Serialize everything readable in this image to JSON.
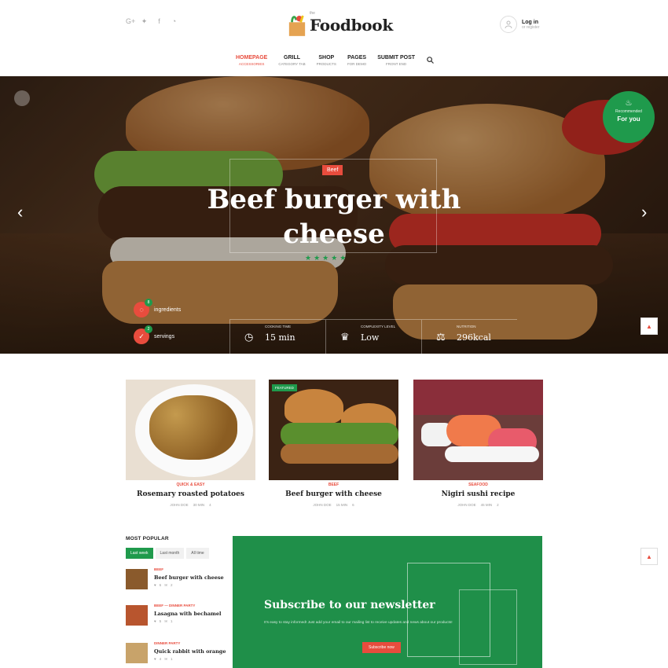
{
  "header": {
    "social_icons": [
      "google-plus-icon",
      "twitter-icon",
      "facebook-icon",
      "rss-icon"
    ],
    "social_glyphs": [
      "G+",
      "✦",
      "f",
      "◔"
    ],
    "logo_small": "the",
    "logo_text": "Foodbook",
    "login_label": "Log in",
    "login_sub": "or register"
  },
  "nav": {
    "items": [
      {
        "label": "HOMEPAGE",
        "sub": "ACCESSORIES",
        "active": true
      },
      {
        "label": "GRILL",
        "sub": "CATEGORY TAB"
      },
      {
        "label": "SHOP",
        "sub": "PRODUCTS"
      },
      {
        "label": "PAGES",
        "sub": "FOR DEMO"
      },
      {
        "label": "SUBMIT POST",
        "sub": "FRONT END"
      }
    ]
  },
  "hero": {
    "category": "Beef",
    "title_line1": "Beef burger with",
    "title_line2": "cheese",
    "rating_stars": "★★★★★",
    "badge_sub": "Recommended",
    "badge_label": "For you",
    "ingredients_label": "ingredients",
    "ingredients_count": "8",
    "servings_label": "servings",
    "servings_count": "2",
    "stats": [
      {
        "label": "COOKING TIME",
        "value": "15 min",
        "icon": "clock-icon"
      },
      {
        "label": "COMPLEXITY LEVEL",
        "value": "Low",
        "icon": "chef-hat-icon"
      },
      {
        "label": "NUTRITION",
        "value": "296kcal",
        "icon": "scale-icon"
      }
    ]
  },
  "cards": [
    {
      "category": "QUICK & EASY",
      "title": "Rosemary roasted potatoes",
      "author": "JOHN DOE",
      "time": "30 MIN",
      "likes": "4",
      "featured": ""
    },
    {
      "category": "BEEF",
      "title": "Beef burger with cheese",
      "author": "JOHN DOE",
      "time": "15 MIN",
      "likes": "6",
      "featured": "FEATURED"
    },
    {
      "category": "SEAFOOD",
      "title": "Nigiri sushi recipe",
      "author": "JOHN DOE",
      "time": "45 MIN",
      "likes": "2",
      "featured": ""
    }
  ],
  "popular": {
    "heading": "MOST POPULAR",
    "tabs": [
      "Last week",
      "Last month",
      "All time"
    ],
    "items": [
      {
        "category": "BEEF",
        "title": "Beef burger with cheese",
        "likes": "6",
        "comments": "2"
      },
      {
        "category": "BEEF  —  DINNER PARTY",
        "title": "Lasagna with bechamel",
        "likes": "5",
        "comments": "1"
      },
      {
        "category": "DINNER PARTY",
        "title": "Quick rabbit with orange",
        "likes": "4",
        "comments": "1"
      }
    ]
  },
  "newsletter": {
    "title": "Subscribe to our newsletter",
    "text": "It's easy to stay informed! Just add your email to our mailing list to receive updates and news about our products!",
    "button": "Subscribe now"
  }
}
